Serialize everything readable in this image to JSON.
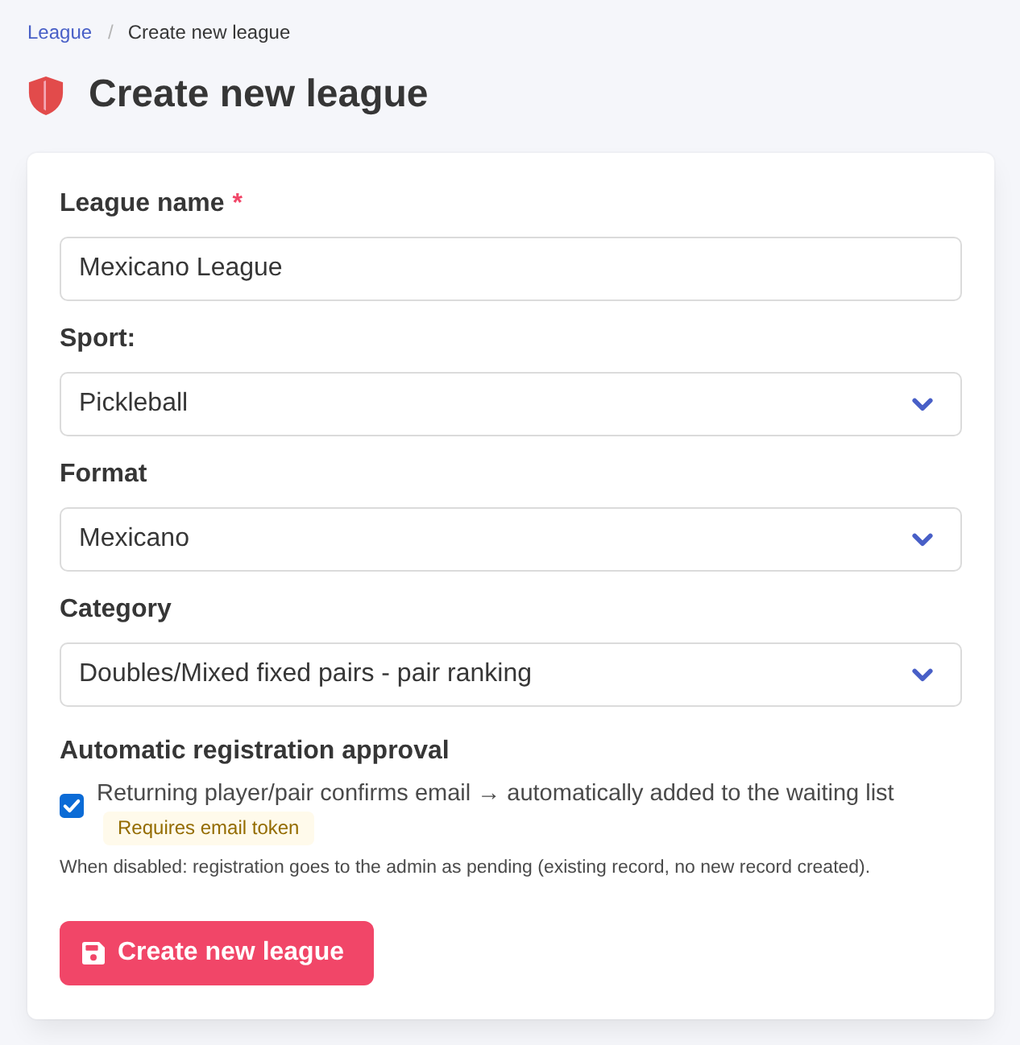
{
  "breadcrumb": {
    "separator": "/",
    "items": [
      {
        "label": "League",
        "kind": "link"
      },
      {
        "label": "Create new league",
        "kind": "current"
      }
    ]
  },
  "page_title": "Create new league",
  "form": {
    "fields": [
      {
        "kind": "text",
        "label": "League name",
        "required_mark": "*",
        "value": "Mexicano League"
      },
      {
        "kind": "select",
        "label": "Sport:",
        "value": "Pickleball"
      },
      {
        "kind": "select",
        "label": "Format",
        "value": "Mexicano"
      },
      {
        "kind": "select",
        "label": "Category",
        "value": "Doubles/Mixed fixed pairs - pair ranking"
      }
    ],
    "auto_approval": {
      "heading": "Automatic registration approval",
      "checkbox": {
        "checked": true,
        "label": "Returning player/pair confirms email → automatically added to the waiting list"
      },
      "badge": "Requires email token",
      "help": "When disabled: registration goes to the admin as pending (existing record, no new record created)."
    },
    "submit_button": "Create new league"
  }
}
